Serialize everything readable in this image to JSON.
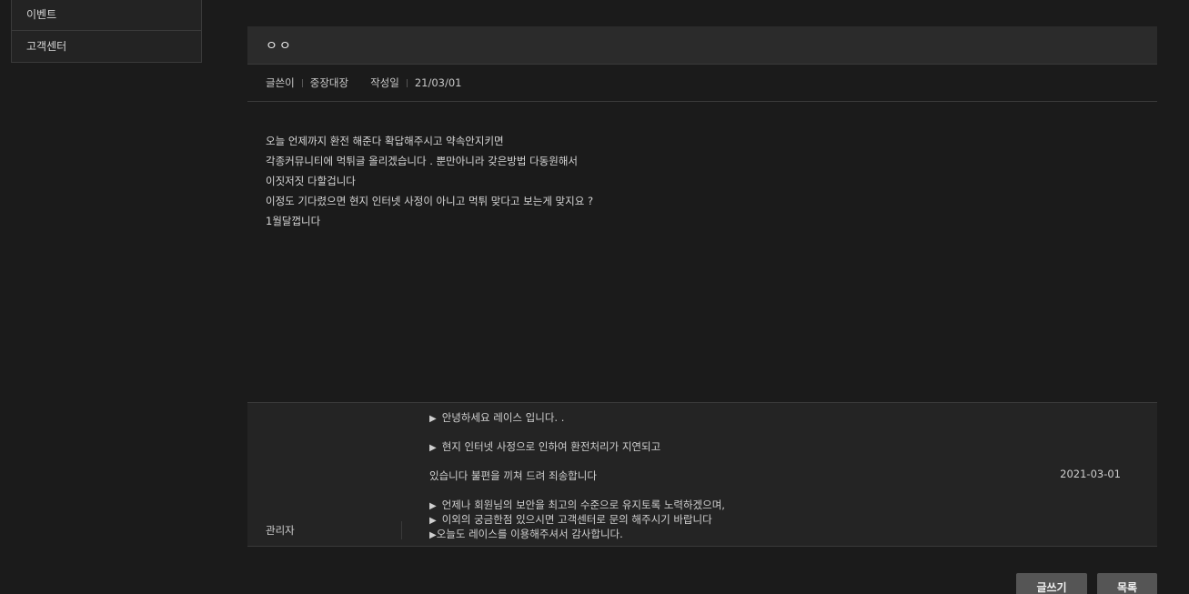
{
  "sidebar": {
    "items": [
      {
        "label": "이벤트"
      },
      {
        "label": "고객센터"
      }
    ]
  },
  "post": {
    "title": "ㅇㅇ",
    "meta": {
      "author_label": "글쓴이",
      "author": "중장대장",
      "date_label": "작성일",
      "date": "21/03/01"
    },
    "body": [
      "오늘 언제까지 환전 해준다 확답해주시고 약속안지키면",
      "각종커뮤니티에 먹튀글 올리겠습니다 . 뿐만아니라 갖은방법 다동원해서",
      "이짓저짓 다할겁니다",
      "이정도 기다렸으면 현지 인터넷 사정이 아니고 먹튀 맞다고 보는게 맞지요 ?",
      "1월달껍니다"
    ]
  },
  "reply": {
    "author": "관리자",
    "date": "2021-03-01",
    "lines": [
      "안녕하세요 레이스 입니다. .",
      "현지 인터넷 사정으로 인하여 환전처리가 지연되고",
      "있습니다 불편을 끼쳐 드려 죄송합니다",
      "언제나 회원님의 보안을 최고의 수준으로 유지토록 노력하겠으며,",
      "이외의 궁금한점 있으시면 고객센터로 문의 해주시기 바랍니다",
      "오늘도 레이스를 이용해주셔서 감사합니다."
    ]
  },
  "buttons": {
    "write": "글쓰기",
    "list": "목록"
  }
}
